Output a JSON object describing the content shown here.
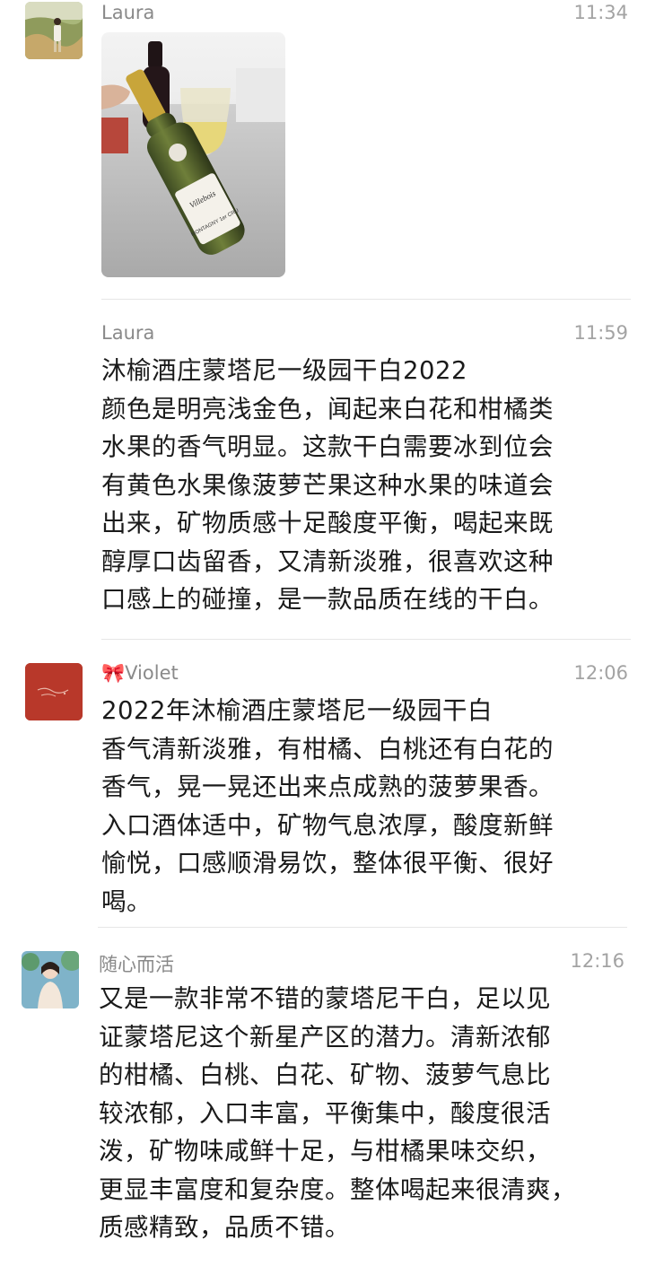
{
  "messages": [
    {
      "author": "Laura",
      "time": "11:34",
      "attachment": "photo"
    },
    {
      "author": "Laura",
      "time": "11:59",
      "lines": [
        "沐榆酒庄蒙塔尼一级园干白2022",
        "颜色是明亮浅金色，闻起来白花和柑橘类",
        "水果的香气明显。这款干白需要冰到位会",
        "有黄色水果像菠萝芒果这种水果的味道会",
        "出来，矿物质感十足酸度平衡，喝起来既",
        "醇厚口齿留香，又清新淡雅，很喜欢这种",
        "口感上的碰撞，是一款品质在线的干白。"
      ]
    },
    {
      "author": "Violet",
      "author_prefix": "🎀",
      "time": "12:06",
      "lines": [
        "2022年沐榆酒庄蒙塔尼一级园干白",
        "香气清新淡雅，有柑橘、白桃还有白花的",
        "香气，晃一晃还出来点成熟的菠萝果香。",
        "入口酒体适中，矿物气息浓厚，酸度新鲜",
        "愉悦，口感顺滑易饮，整体很平衡、很好",
        "喝。"
      ]
    },
    {
      "author": "随心而活",
      "time": "12:16",
      "lines": [
        "又是一款非常不错的蒙塔尼干白，足以见",
        "证蒙塔尼这个新星产区的潜力。清新浓郁",
        "的柑橘、白桃、白花、矿物、菠萝气息比",
        "较浓郁，入口丰富，平衡集中，酸度很活",
        "泼，矿物味咸鲜十足，与柑橘果味交织，",
        "更显丰富度和复杂度。整体喝起来很清爽，",
        "质感精致，品质不错。"
      ]
    }
  ],
  "bottle_label": {
    "brand": "Villebois",
    "appellation": "MONTAGNY 1er CRU"
  },
  "colors": {
    "name": "#8a8a8a",
    "time": "#a3a3a3",
    "text": "#1a1a1a",
    "divider": "#e6e6e6",
    "violet_avatar": "#b8382a"
  }
}
